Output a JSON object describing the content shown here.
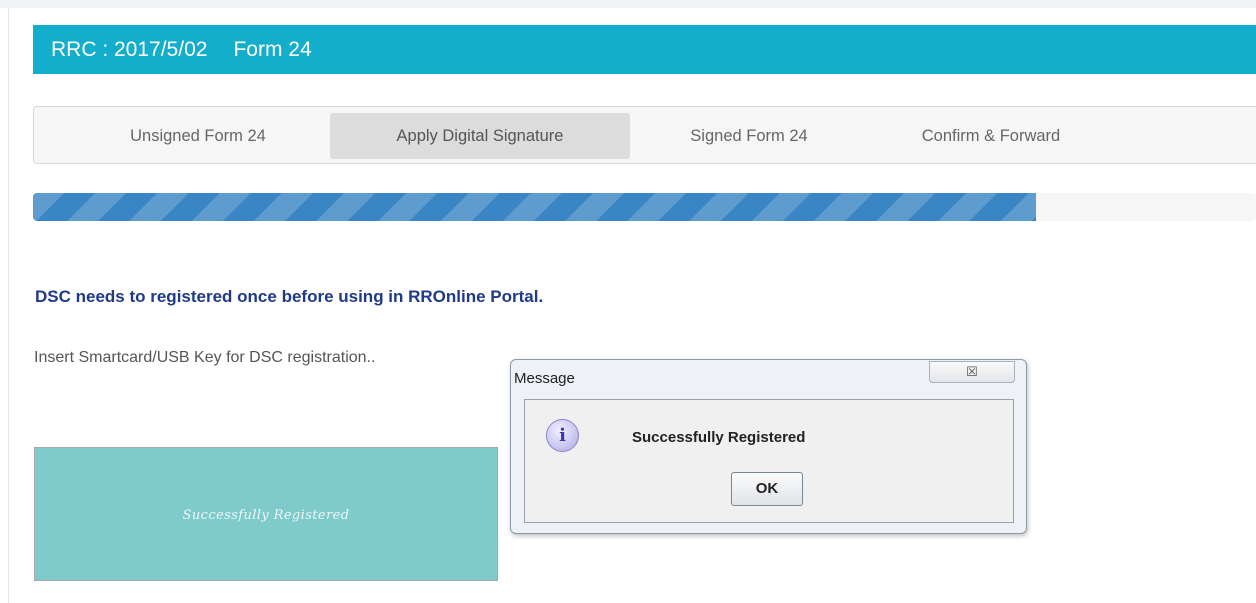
{
  "header": {
    "ref_number": "RRC : 2017/5/02",
    "form_name": "Form 24"
  },
  "tabs": [
    {
      "label": "Unsigned Form 24",
      "active": false
    },
    {
      "label": "Apply Digital Signature",
      "active": true
    },
    {
      "label": "Signed Form 24",
      "active": false
    },
    {
      "label": "Confirm & Forward",
      "active": false
    }
  ],
  "progress": {
    "percent": 82
  },
  "main": {
    "dsc_notice": "DSC needs to registered once before using in RROnline Portal.",
    "insert_text": "Insert Smartcard/USB Key for DSC registration..",
    "status_panel_text": "Successfully Registered"
  },
  "dialog": {
    "title": "Message",
    "close_glyph": "☒",
    "icon": "info-icon",
    "message": "Successfully Registered",
    "ok_label": "OK"
  },
  "colors": {
    "header_bg": "#13aecb",
    "progress_fill": "#3a86c4",
    "notice_text": "#1f3a8a",
    "status_panel_bg": "#7fcaca"
  }
}
